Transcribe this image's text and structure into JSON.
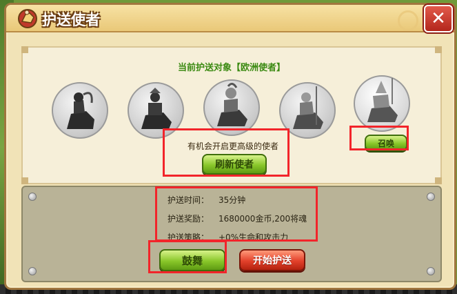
{
  "title": "护送使者",
  "close_label": "✕",
  "current_target": "当前护送对象【欧洲使者】",
  "envoys": [
    {
      "icon": "warrior-icon"
    },
    {
      "icon": "samurai-icon"
    },
    {
      "icon": "knight-icon"
    },
    {
      "icon": "lancer-icon"
    },
    {
      "icon": "pharaoh-icon"
    }
  ],
  "summon_label": "召唤",
  "refresh_hint": "有机会开启更高级的使者",
  "refresh_label": "刷新使者",
  "info": [
    {
      "key": "护送时间：",
      "value": "35分钟"
    },
    {
      "key": "护送奖励：",
      "value": "1680000金币,200将魂"
    },
    {
      "key": "护送策略：",
      "value": "+0%生命和攻击力"
    }
  ],
  "inspire_label": "鼓舞",
  "start_label": "开始护送",
  "colors": {
    "accent_green": "#3b8a12",
    "highlight_red": "#f2242a"
  }
}
